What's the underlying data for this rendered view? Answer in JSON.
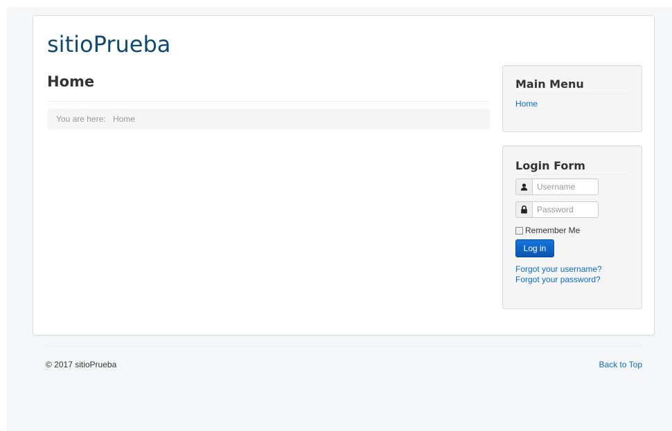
{
  "site": {
    "title": "sitioPrueba"
  },
  "main": {
    "heading": "Home",
    "breadcrumb": {
      "prefix": "You are here:",
      "current": "Home"
    }
  },
  "menu_module": {
    "title": "Main Menu",
    "items": [
      "Home"
    ]
  },
  "login_module": {
    "title": "Login Form",
    "username_placeholder": "Username",
    "password_placeholder": "Password",
    "username_icon": "user-icon",
    "password_icon": "lock-icon",
    "remember_label": "Remember Me",
    "submit_label": "Log in",
    "forgot_username": "Forgot your username?",
    "forgot_password": "Forgot your password?"
  },
  "footer": {
    "copyright": "© 2017 sitioPrueba",
    "back_to_top": "Back to Top"
  },
  "colors": {
    "brand": "#0f4a6e",
    "link": "#0b6bbf",
    "button": "#0c5fc0"
  }
}
